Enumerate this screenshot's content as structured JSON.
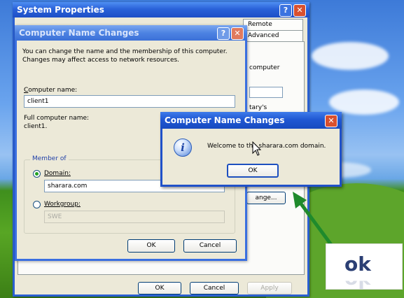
{
  "system_properties": {
    "title": "System Properties",
    "tabs": [
      "Remote",
      "Advanced"
    ],
    "partial_texts": [
      "computer",
      "tary's"
    ],
    "change_button": "ange...",
    "ok_button": "OK",
    "cancel_button": "Cancel",
    "apply_button": "Apply"
  },
  "computer_name_changes": {
    "title": "Computer Name Changes",
    "description": "You can change the name and the membership of this computer. Changes may affect access to network resources.",
    "computer_name_label": "Computer name:",
    "computer_name_value": "client1",
    "full_name_label": "Full computer name:",
    "full_name_value": "client1.",
    "member_of_label": "Member of",
    "domain_label": "Domain:",
    "domain_value": "sharara.com",
    "workgroup_label": "Workgroup:",
    "workgroup_value": "SWE",
    "member_selection": "domain",
    "ok_button": "OK",
    "cancel_button": "Cancel"
  },
  "welcome_dialog": {
    "title": "Computer Name Changes",
    "message": "Welcome to the sharara.com domain.",
    "ok_button": "OK",
    "icon": "info-icon"
  },
  "annotation": {
    "text": "ok",
    "arrow_color": "#1f8a2c"
  }
}
